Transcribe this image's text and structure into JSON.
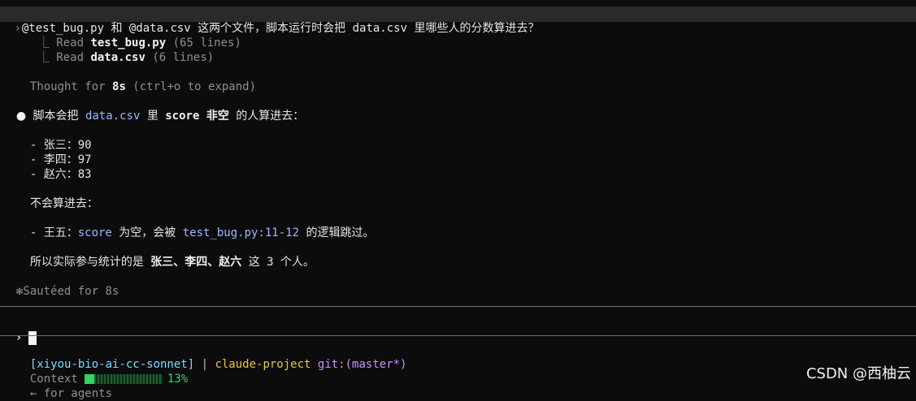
{
  "prompt": {
    "text_a": "@test_bug.py",
    "text_b": " 和 ",
    "text_c": "@data.csv",
    "text_d": " 这两个文件，脚本运行时会把 ",
    "text_e": "data.csv",
    "text_f": " 里哪些人的分数算进去？"
  },
  "activity": {
    "read_1_label": "Read ",
    "read_1_file": "test_bug.py",
    "read_1_meta": " (65 lines)",
    "read_2_label": "Read ",
    "read_2_file": "data.csv",
    "read_2_meta": " (6 lines)",
    "thought_prefix": "Thought for ",
    "thought_time": "8s",
    "thought_suffix": " (ctrl+o to expand)"
  },
  "answer": {
    "bullet": "●",
    "intro_a": "脚本会把 ",
    "intro_b": "data.csv",
    "intro_c": " 里 ",
    "intro_d": "score",
    "intro_e": " 非空",
    "intro_f": " 的人算进去：",
    "included": [
      {
        "name": "- 张三：",
        "score": "90"
      },
      {
        "name": "- 李四：",
        "score": "97"
      },
      {
        "name": "- 赵六：",
        "score": "83"
      }
    ],
    "excluded_heading": "不会算进去：",
    "excluded_a": "- 王五：",
    "excluded_b": "score",
    "excluded_c": " 为空，会被 ",
    "excluded_d": "test_bug.py:11-12",
    "excluded_e": " 的逻辑跳过。",
    "summary_a": "所以实际参与统计的是 ",
    "summary_b": "张三、李四、赵六",
    "summary_c": " 这 ",
    "summary_d": "3",
    "summary_e": " 个人。"
  },
  "status": {
    "star": "✻",
    "text": "Sautéed for 8s"
  },
  "input": {
    "prompt_symbol": "›",
    "value": ""
  },
  "footer": {
    "session": "[xiyou-bio-ai-cc-sonnet]",
    "pipe": " | ",
    "project": "claude-project",
    "git_label": " git:",
    "git_branch": "(master*)",
    "context_label": "Context",
    "context_percent": "13%",
    "context_fraction": 0.13,
    "agents": "← for agents"
  },
  "watermark": "CSDN @西柚云"
}
